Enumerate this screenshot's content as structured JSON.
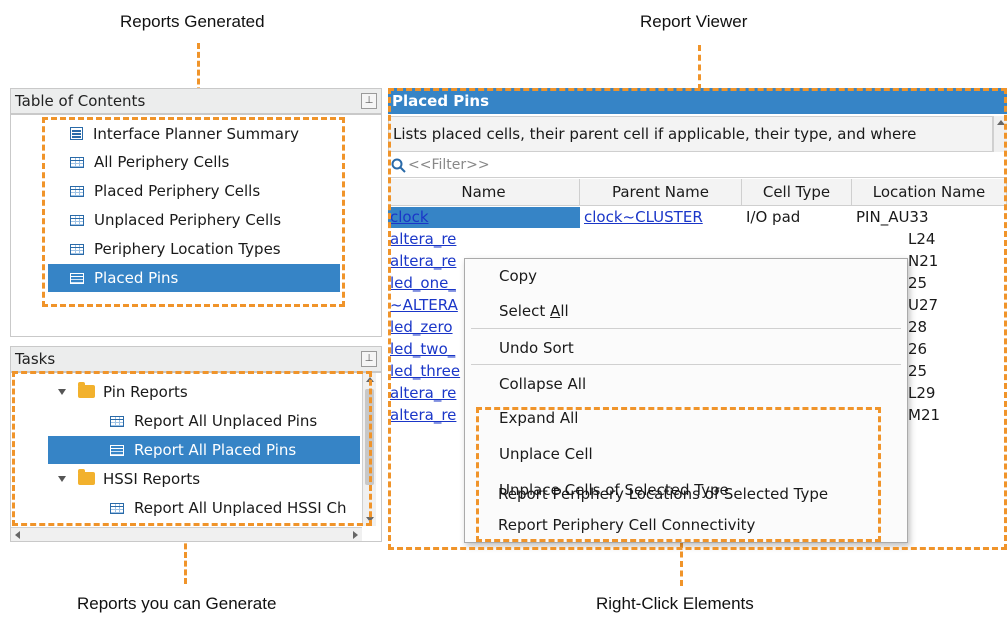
{
  "callouts": {
    "reports_generated": "Reports Generated",
    "report_viewer": "Report Viewer",
    "reports_you_can_generate": "Reports you can Generate",
    "right_click_elements": "Right-Click Elements"
  },
  "toc": {
    "title": "Table of Contents",
    "pin": "⊥",
    "items": [
      {
        "label": "Interface Planner Summary",
        "icon": "summary-icon"
      },
      {
        "label": "All Periphery Cells",
        "icon": "table-icon"
      },
      {
        "label": "Placed Periphery Cells",
        "icon": "table-icon"
      },
      {
        "label": "Unplaced Periphery Cells",
        "icon": "table-icon"
      },
      {
        "label": "Periphery Location Types",
        "icon": "table-icon"
      },
      {
        "label": "Placed Pins",
        "icon": "table-icon",
        "selected": true
      }
    ]
  },
  "tasks": {
    "title": "Tasks",
    "pin": "⊥",
    "items": [
      {
        "label": "Pin Reports",
        "type": "folder"
      },
      {
        "label": "Report All Unplaced Pins",
        "type": "report"
      },
      {
        "label": "Report All Placed Pins",
        "type": "report",
        "selected": true
      },
      {
        "label": "HSSI Reports",
        "type": "folder"
      },
      {
        "label": "Report All Unplaced HSSI Ch",
        "type": "report"
      }
    ]
  },
  "viewer": {
    "title": "Placed Pins",
    "description": "Lists placed cells, their parent cell if applicable, their type, and where",
    "filter_placeholder": "<<Filter>>",
    "columns": [
      "Name",
      "Parent Name",
      "Cell Type",
      "Location Name"
    ],
    "first_row": {
      "name": "clock",
      "parent": "clock~CLUSTER",
      "type": "I/O pad",
      "location": "PIN_AU33"
    },
    "names": [
      "altera_re",
      "altera_re",
      "led_one_",
      "~ALTERA",
      "led_zero",
      "led_two_",
      "led_three",
      "altera_re",
      "altera_re"
    ],
    "locations": [
      "L24",
      "N21",
      "25",
      "U27",
      "28",
      "26",
      "25",
      "L29",
      "M21"
    ]
  },
  "context_menu": {
    "items": [
      {
        "label": "Copy"
      },
      {
        "label": "Select All"
      },
      {
        "label": "Undo Sort"
      },
      {
        "label": "Collapse All"
      },
      {
        "label": "Expand All"
      },
      {
        "label": "Unplace Cell"
      },
      {
        "label": "Unplace Cells of Selected Type"
      },
      {
        "label": "Report Periphery Locations of Selected Type"
      },
      {
        "label": "Report Periphery Cell Connectivity"
      }
    ]
  },
  "colors": {
    "accent": "#3684c6",
    "callout_dash": "#f0942a",
    "link": "#1a36c8"
  }
}
